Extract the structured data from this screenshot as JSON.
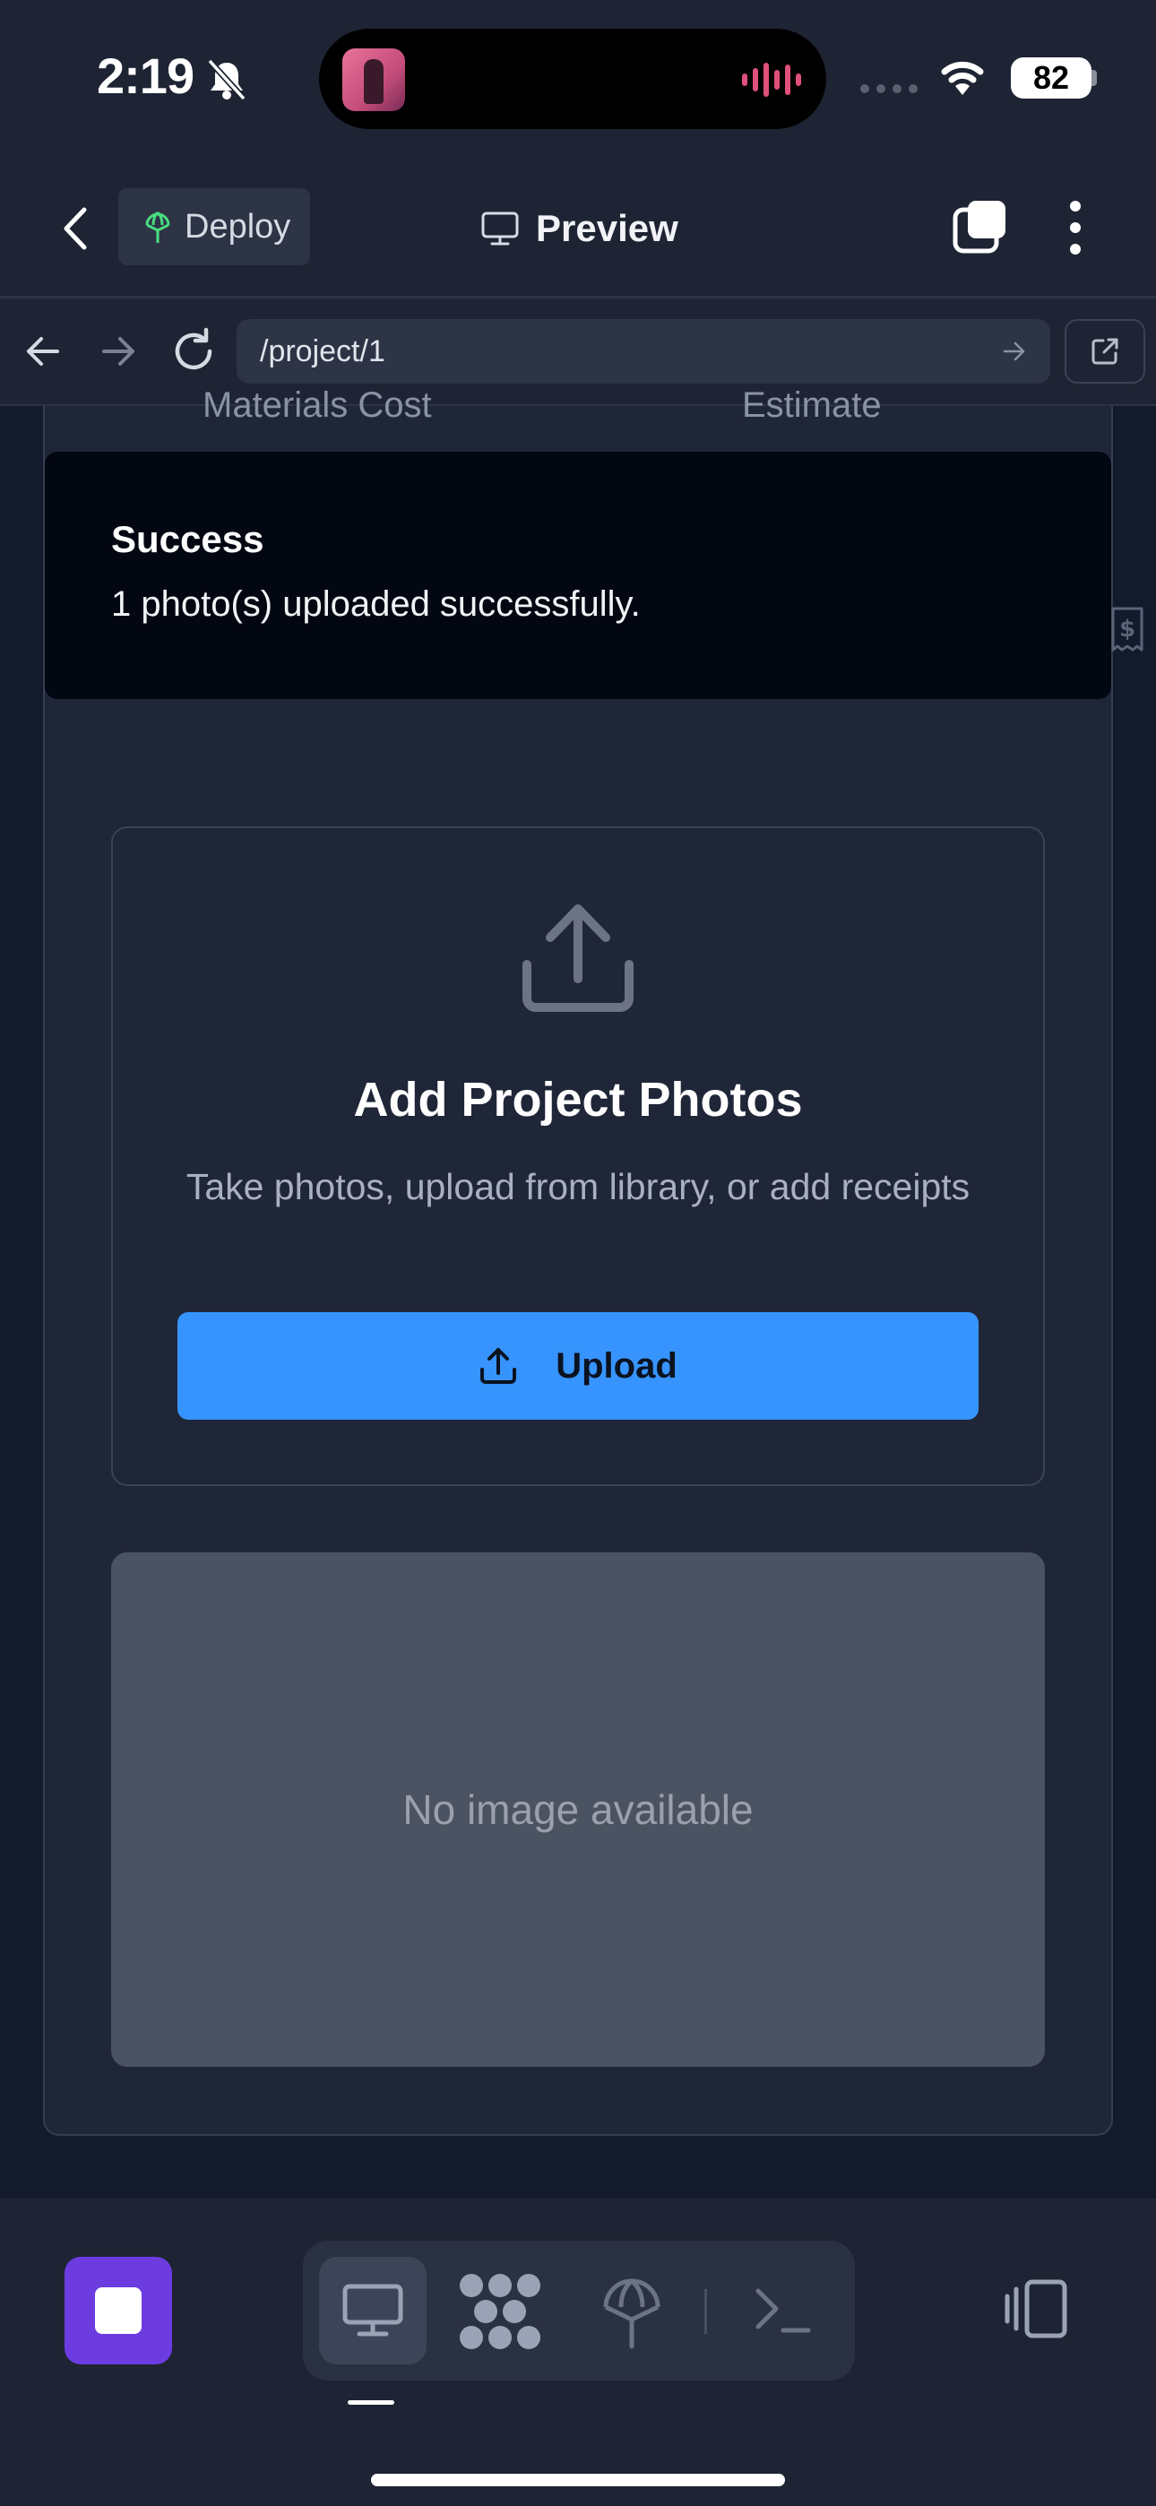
{
  "status_bar": {
    "time": "2:19",
    "battery": "82"
  },
  "header": {
    "deploy_label": "Deploy",
    "title": "Preview"
  },
  "url_bar": {
    "url": "/project/1"
  },
  "content": {
    "cut_off_labels": [
      "Materials Cost",
      "Estimate"
    ],
    "toast": {
      "title": "Success",
      "message": "1 photo(s) uploaded successfully."
    },
    "upload": {
      "heading": "Add Project Photos",
      "description": "Take photos, upload from library, or add receipts",
      "button_label": "Upload"
    },
    "image_placeholder": "No image available"
  },
  "colors": {
    "background": "#1e2433",
    "accent": "#3794ff",
    "stop_button": "#6c3ce0"
  }
}
